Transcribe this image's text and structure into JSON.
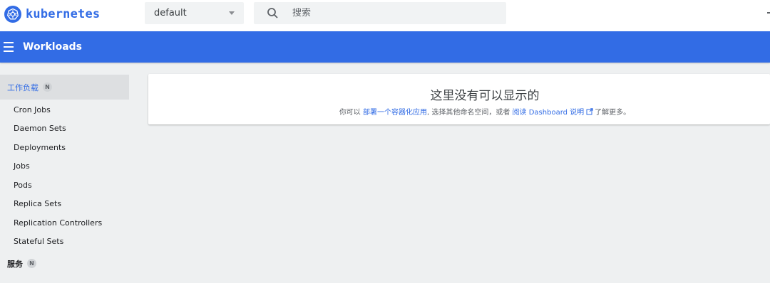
{
  "brand": {
    "name": "kubernetes",
    "color": "#326ce5",
    "icon": "kubernetes-logo-icon"
  },
  "namespace": {
    "selected": "default"
  },
  "search": {
    "placeholder": "搜索",
    "icon": "search-icon"
  },
  "toolbar": {
    "title": "Workloads",
    "menu_icon": "hamburger-menu-icon"
  },
  "sidebar": {
    "category_workloads": {
      "label": "工作负载",
      "badge": "N"
    },
    "items": [
      {
        "label": "Cron Jobs"
      },
      {
        "label": "Daemon Sets"
      },
      {
        "label": "Deployments"
      },
      {
        "label": "Jobs"
      },
      {
        "label": "Pods"
      },
      {
        "label": "Replica Sets"
      },
      {
        "label": "Replication Controllers"
      },
      {
        "label": "Stateful Sets"
      }
    ],
    "category_services": {
      "label": "服务",
      "badge": "N"
    }
  },
  "empty_state": {
    "title": "这里没有可以显示的",
    "prefix": "你可以 ",
    "deploy_link": "部署一个容器化应用",
    "middle": ", 选择其他命名空间，或者 ",
    "docs_link": "阅读 Dashboard 说明",
    "suffix": "了解更多。"
  },
  "colors": {
    "accent": "#326ce5",
    "background": "#eef0f1",
    "active_nav": "#dddfe1"
  }
}
